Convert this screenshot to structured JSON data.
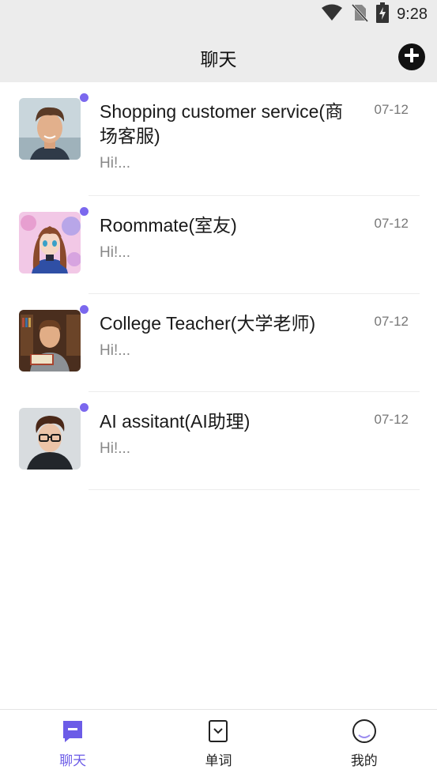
{
  "status_bar": {
    "time": "9:28",
    "icons": [
      "wifi-icon",
      "no-sim-icon",
      "battery-charging-icon"
    ]
  },
  "header": {
    "title": "聊天",
    "add_icon": "plus-circle-icon"
  },
  "chats": [
    {
      "name": "Shopping customer service(商场客服)",
      "date": "07-12",
      "preview": "Hi!...",
      "avatar": "young-man-avatar",
      "unread": true
    },
    {
      "name": "Roommate(室友)",
      "date": "07-12",
      "preview": "Hi!...",
      "avatar": "anime-girl-avatar",
      "unread": true
    },
    {
      "name": "College Teacher(大学老师)",
      "date": "07-12",
      "preview": "Hi!...",
      "avatar": "teacher-with-book-avatar",
      "unread": true
    },
    {
      "name": "AI assitant(AI助理)",
      "date": "07-12",
      "preview": "Hi!...",
      "avatar": "man-with-glasses-avatar",
      "unread": true
    }
  ],
  "tabs": [
    {
      "label": "聊天",
      "icon": "chat-icon",
      "active": true
    },
    {
      "label": "单词",
      "icon": "bookmark-icon",
      "active": false
    },
    {
      "label": "我的",
      "icon": "profile-icon",
      "active": false
    }
  ],
  "colors": {
    "accent": "#6c5ce7",
    "unread_dot": "#7b68ee",
    "header_bg": "#ececec"
  }
}
